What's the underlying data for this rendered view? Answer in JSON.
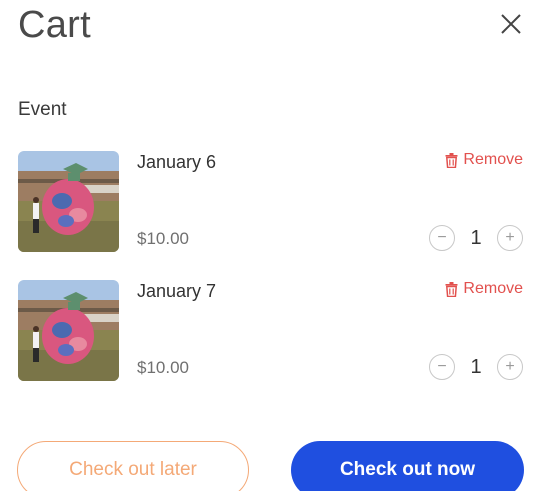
{
  "header": {
    "title": "Cart",
    "close_icon": "close-icon"
  },
  "section": {
    "label": "Event"
  },
  "items": [
    {
      "name": "January 6",
      "price": "$10.00",
      "remove_label": "Remove",
      "quantity": "1",
      "minus": "−",
      "plus": "+"
    },
    {
      "name": "January 7",
      "price": "$10.00",
      "remove_label": "Remove",
      "quantity": "1",
      "minus": "−",
      "plus": "+"
    }
  ],
  "actions": {
    "later_label": "Check out later",
    "now_label": "Check out now"
  },
  "colors": {
    "remove": "#e2514e",
    "primary": "#1f4fe0",
    "secondary": "#f4a977"
  }
}
